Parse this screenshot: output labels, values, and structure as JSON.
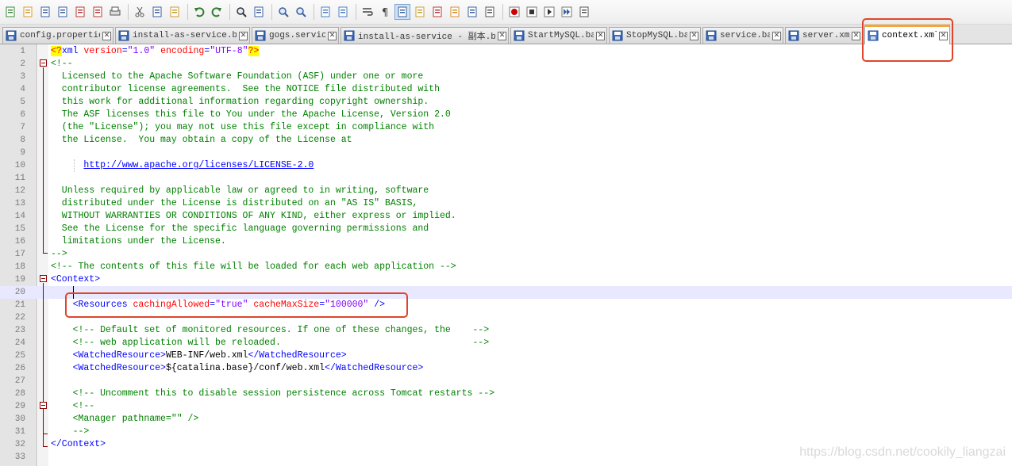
{
  "toolbar": {
    "buttons": [
      "new-file-icon",
      "open-file-icon",
      "save-icon",
      "save-all-icon",
      "close-icon",
      "close-all-icon",
      "print-icon",
      "cut-icon",
      "copy-icon",
      "paste-icon",
      "undo-icon",
      "redo-icon",
      "find-icon",
      "replace-icon",
      "zoom-in-icon",
      "zoom-out-icon",
      "sync-vertical-icon",
      "sync-horizontal-icon",
      "word-wrap-icon",
      "show-all-chars-icon",
      "indent-guide-icon",
      "user-language-icon",
      "function-list-icon",
      "folder-as-workspace-icon",
      "doc-map-icon",
      "monitoring-icon",
      "record-macro-icon",
      "stop-record-icon",
      "play-macro-icon",
      "run-macro-multiple-icon",
      "save-macro-icon"
    ]
  },
  "tabs": [
    {
      "label": "config.properties",
      "icon": "file-icon",
      "active": false
    },
    {
      "label": "install-as-service.bat",
      "icon": "file-icon",
      "active": false
    },
    {
      "label": "gogs.service",
      "icon": "file-icon",
      "active": false
    },
    {
      "label": "install-as-service - 副本.bat",
      "icon": "file-icon",
      "active": false
    },
    {
      "label": "StartMySQL.bat",
      "icon": "file-icon",
      "active": false
    },
    {
      "label": "StopMySQL.bat",
      "icon": "file-icon",
      "active": false
    },
    {
      "label": "service.bat",
      "icon": "file-icon",
      "active": false
    },
    {
      "label": "server.xml",
      "icon": "file-icon",
      "active": false
    },
    {
      "label": "context.xml",
      "icon": "file-icon",
      "active": true
    }
  ],
  "close_glyph": "✕",
  "code_lines": [
    [
      [
        "pi",
        "<?"
      ],
      [
        "tag",
        "xml "
      ],
      [
        "attr",
        "version"
      ],
      [
        "tag",
        "="
      ],
      [
        "val",
        "\"1.0\""
      ],
      [
        "tag",
        " "
      ],
      [
        "attr",
        "encoding"
      ],
      [
        "tag",
        "="
      ],
      [
        "val",
        "\"UTF-8\""
      ],
      [
        "pi",
        "?>"
      ]
    ],
    [
      [
        "comment",
        "<!--"
      ]
    ],
    [
      [
        "comment",
        "  Licensed to the Apache Software Foundation (ASF) under one or more"
      ]
    ],
    [
      [
        "comment",
        "  contributor license agreements.  See the NOTICE file distributed with"
      ]
    ],
    [
      [
        "comment",
        "  this work for additional information regarding copyright ownership."
      ]
    ],
    [
      [
        "comment",
        "  The ASF licenses this file to You under the Apache License, Version 2.0"
      ]
    ],
    [
      [
        "comment",
        "  (the \"License\"); you may not use this file except in compliance with"
      ]
    ],
    [
      [
        "comment",
        "  the License.  You may obtain a copy of the License at"
      ]
    ],
    [],
    [
      [
        "comment",
        "      "
      ],
      [
        "url",
        "http://www.apache.org/licenses/LICENSE-2.0"
      ]
    ],
    [],
    [
      [
        "comment",
        "  Unless required by applicable law or agreed to in writing, software"
      ]
    ],
    [
      [
        "comment",
        "  distributed under the License is distributed on an \"AS IS\" BASIS,"
      ]
    ],
    [
      [
        "comment",
        "  WITHOUT WARRANTIES OR CONDITIONS OF ANY KIND, either express or implied."
      ]
    ],
    [
      [
        "comment",
        "  See the License for the specific language governing permissions and"
      ]
    ],
    [
      [
        "comment",
        "  limitations under the License."
      ]
    ],
    [
      [
        "comment",
        "-->"
      ]
    ],
    [
      [
        "comment",
        "<!-- The contents of this file will be loaded for each web application -->"
      ]
    ],
    [
      [
        "tag",
        "<Context>"
      ]
    ],
    [],
    [
      [
        "text",
        "    "
      ],
      [
        "tag",
        "<Resources "
      ],
      [
        "attr",
        "cachingAllowed"
      ],
      [
        "tag",
        "="
      ],
      [
        "val",
        "\"true\""
      ],
      [
        "tag",
        " "
      ],
      [
        "attr",
        "cacheMaxSize"
      ],
      [
        "tag",
        "="
      ],
      [
        "val",
        "\"100000\""
      ],
      [
        "tag",
        " />"
      ]
    ],
    [],
    [
      [
        "comment",
        "    <!-- Default set of monitored resources. If one of these changes, the    -->"
      ]
    ],
    [
      [
        "comment",
        "    <!-- web application will be reloaded.                                   -->"
      ]
    ],
    [
      [
        "text",
        "    "
      ],
      [
        "tag",
        "<WatchedResource>"
      ],
      [
        "text",
        "WEB-INF/web.xml"
      ],
      [
        "tag",
        "</WatchedResource>"
      ]
    ],
    [
      [
        "text",
        "    "
      ],
      [
        "tag",
        "<WatchedResource>"
      ],
      [
        "text",
        "${catalina.base}/conf/web.xml"
      ],
      [
        "tag",
        "</WatchedResource>"
      ]
    ],
    [],
    [
      [
        "comment",
        "    <!-- Uncomment this to disable session persistence across Tomcat restarts -->"
      ]
    ],
    [
      [
        "comment",
        "    <!--"
      ]
    ],
    [
      [
        "comment",
        "    <Manager pathname=\"\" />"
      ]
    ],
    [
      [
        "comment",
        "    -->"
      ]
    ],
    [
      [
        "tag",
        "</Context>"
      ]
    ],
    []
  ],
  "current_line": 20,
  "watermark": "https://blog.csdn.net/cookily_liangzai"
}
